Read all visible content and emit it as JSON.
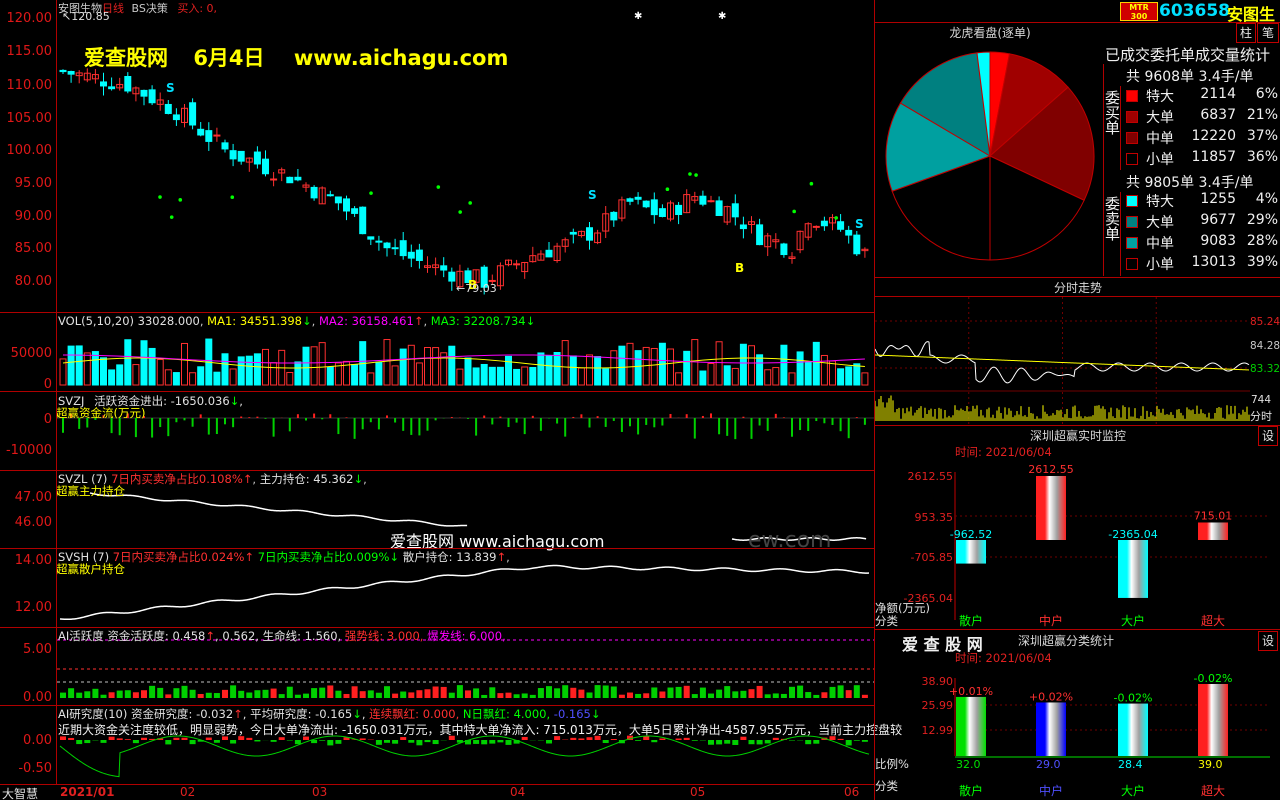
{
  "window": {
    "title_stock": "安图生物",
    "title_ext": "日线",
    "strategy": "BS决策",
    "buy_label": "买入: 0,",
    "high_marker": "120.85",
    "low_marker": "79.03",
    "watermark_left": "爱查股网",
    "watermark_date": "6月4日",
    "watermark_url": "www.aichagu.com",
    "watermark_center": "爱查股网   www.aichagu.com",
    "watermark_faded": "ew.com",
    "bottom_brand": "大智慧"
  },
  "price_axis": [
    "115.00",
    "110.00",
    "105.00",
    "100.00",
    "95.00",
    "90.00",
    "85.00",
    "80.00",
    "120.00"
  ],
  "signals": {
    "s1": "S",
    "s2": "S",
    "s3": "S",
    "b1": "B",
    "b2": "B"
  },
  "vol": {
    "label": "VOL(5,10,20)",
    "v": "33028.000",
    "ma1_label": "MA1:",
    "ma1": "34551.398",
    "ma2_label": "MA2:",
    "ma2": "36158.461",
    "ma3_label": "MA3:",
    "ma3": "32208.734",
    "axis": [
      "50000",
      "0"
    ]
  },
  "svzj": {
    "name": "SVZJ",
    "title": "活跃资金进出:",
    "value": "-1650.036",
    "sub": "超赢资金流(万元)",
    "axis": [
      "0",
      "-10000"
    ]
  },
  "svzl": {
    "name": "SVZL (7)",
    "t1": "7日内买卖净占比",
    "v1": "0.108%",
    "t2": "主力持仓:",
    "v2": "45.362",
    "sub": "超赢主力持仓",
    "axis": [
      "47.00",
      "46.00"
    ]
  },
  "svsh": {
    "name": "SVSH (7)",
    "t1": "7日内买卖净占比",
    "v1": "0.024%",
    "t2": "7日内买卖净占比",
    "v2": "0.009%",
    "t3": "散户持仓:",
    "v3": "13.839",
    "sub": "超赢散户持仓",
    "axis": [
      "14.00",
      "12.00"
    ]
  },
  "ai_active": {
    "title": "AI活跃度",
    "t1": "资金活跃度:",
    "v1": "0.458",
    "v2": "0.562,",
    "t3": "生命线:",
    "v3": "1.560,",
    "t4": "强势线:",
    "v4": "3.000,",
    "t5": "爆发线:",
    "v5": "6.000,",
    "axis": [
      "5.00",
      "0.00"
    ]
  },
  "ai_research": {
    "title": "AI研究度(10)",
    "t1": "资金研究度:",
    "v1": "-0.032",
    "t2": "平均研究度:",
    "v2": "-0.165",
    "t3": "连续飘红:",
    "v3": "0.000,",
    "t4": "N日飘红:",
    "v4": "4.000,",
    "v5": "-0.165",
    "axis": [
      "0.00",
      "-0.50"
    ],
    "narrative": "近期大资金关注度较低，明显弱势，今日大单净流出: -1650.031万元，其中特大单净流入: 715.013万元，大单5日累计净出-4587.955万元，当前主力控盘较"
  },
  "x_axis": [
    "2021/01",
    "02",
    "03",
    "04",
    "05",
    "06"
  ],
  "header": {
    "logo_top": "MTR",
    "logo_bottom": "300",
    "code": "603658",
    "name": "安图生",
    "btn_zhu": "柱",
    "btn_bi": "笔"
  },
  "longhu": {
    "title": "龙虎看盘(逐单)",
    "subtitle": "已成交委托单成交量统计",
    "buy_side": "委买单",
    "sell_side": "委卖单",
    "buy_total": "共 9608单 3.4手/单",
    "sell_total": "共 9805单 3.4手/单",
    "buy": [
      {
        "label": "特大",
        "count": "2114",
        "pct": "6%",
        "color": "#ff0000"
      },
      {
        "label": "大单",
        "count": "6837",
        "pct": "21%",
        "color": "#a00000"
      },
      {
        "label": "中单",
        "count": "12220",
        "pct": "37%",
        "color": "#800000"
      },
      {
        "label": "小单",
        "count": "11857",
        "pct": "36%",
        "color": "#000000"
      }
    ],
    "sell": [
      {
        "label": "特大",
        "count": "1255",
        "pct": "4%",
        "color": "#00ffff"
      },
      {
        "label": "大单",
        "count": "9677",
        "pct": "29%",
        "color": "#008080"
      },
      {
        "label": "中单",
        "count": "9083",
        "pct": "28%",
        "color": "#00a0a0"
      },
      {
        "label": "小单",
        "count": "13013",
        "pct": "39%",
        "color": "#000000"
      }
    ]
  },
  "intraday": {
    "title": "分时走势",
    "axis": [
      "85.24",
      "84.28",
      "83.32"
    ],
    "vol_label": "744",
    "vol_unit": "分时"
  },
  "realtime": {
    "title": "深圳超赢实时监控",
    "btn": "设",
    "time": "时间: 2021/06/04",
    "ylabel": "净额(万元)",
    "xlabel": "分类",
    "axis": [
      "2612.55",
      "953.35",
      "-705.85",
      "-2365.04"
    ],
    "cats": [
      "散户",
      "中户",
      "大户",
      "超大"
    ],
    "values": [
      "-962.52",
      "2612.55",
      "-2365.04",
      "715.01"
    ]
  },
  "classstat": {
    "brand": "爱 查 股 网",
    "title": "深圳超赢分类统计",
    "btn": "设",
    "time": "时间: 2021/06/04",
    "ylabel": "比例%",
    "xlabel": "分类",
    "axis": [
      "38.90",
      "25.99",
      "12.99"
    ],
    "cats": [
      "散户",
      "中户",
      "大户",
      "超大"
    ],
    "changes": [
      "+0.01%",
      "+0.02%",
      "-0.02%",
      "-0.02%"
    ],
    "values": [
      "32.0",
      "29.0",
      "28.4",
      "39.0"
    ]
  }
}
